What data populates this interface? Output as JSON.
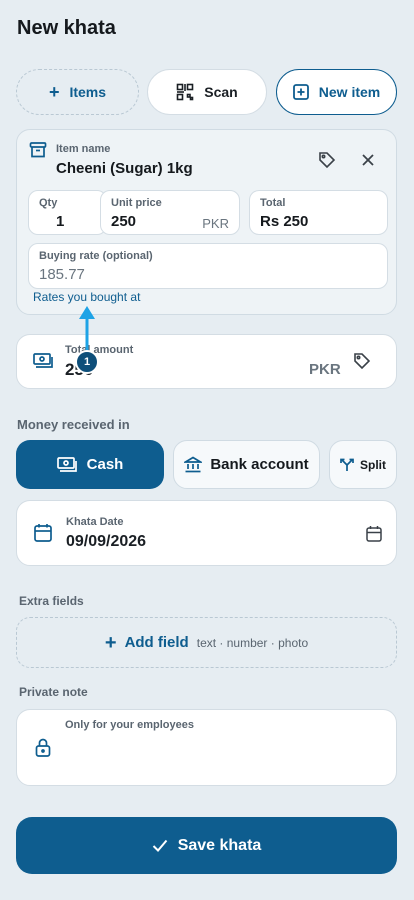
{
  "page_title": "New khata",
  "top_actions": {
    "items_label": "Items",
    "scan_label": "Scan",
    "new_item_label": "New item"
  },
  "item": {
    "name_label": "Item name",
    "name_value": "Cheeni (Sugar) 1kg",
    "qty_label": "Qty",
    "qty_value": "1",
    "unit_price_label": "Unit price",
    "unit_price_value": "250",
    "unit_price_currency": "PKR",
    "total_label": "Total",
    "total_value": "Rs 250",
    "buying_rate_label": "Buying rate (optional)",
    "buying_rate_value": "185.77",
    "buying_rate_hint": "Rates you bought at"
  },
  "annotation": {
    "badge_number": "1"
  },
  "total_amount": {
    "label": "Total amount",
    "value": "250",
    "currency": "PKR"
  },
  "money_received": {
    "label": "Money received in",
    "options": [
      "Cash",
      "Bank account",
      "Split"
    ],
    "selected": "Cash"
  },
  "khata_date": {
    "label": "Khata Date",
    "value": "09/09/2026"
  },
  "extra_fields": {
    "label": "Extra fields",
    "add_label": "Add field",
    "types_hint": "text · number · photo"
  },
  "private_note": {
    "label": "Private note",
    "placeholder": "Only for your employees"
  },
  "save_label": "Save khata",
  "colors": {
    "primary": "#0e5d8f",
    "background": "#e6edf2",
    "annotation_arrow": "#1ea3e6"
  }
}
